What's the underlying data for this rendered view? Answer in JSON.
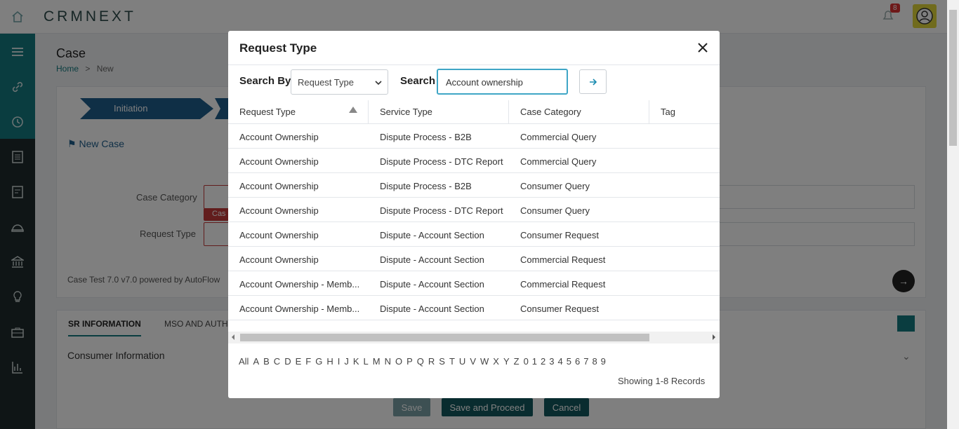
{
  "app": {
    "logo": "CRMNEXT",
    "notification_count": "8"
  },
  "page": {
    "title": "Case",
    "breadcrumb": {
      "home": "Home",
      "sep": ">",
      "current": "New"
    },
    "stage": "Initiation",
    "new_case": "New Case",
    "case_category_label": "Case Category",
    "request_type_label": "Request Type",
    "error_tag": "Cas",
    "powered_by": "Case Test 7.0 v7.0 powered by AutoFlow",
    "tabs": [
      "SR INFORMATION",
      "MSO AND AUTH"
    ],
    "section": "Consumer Information",
    "buttons": {
      "save": "Save",
      "save_proceed": "Save and Proceed",
      "cancel": "Cancel"
    }
  },
  "modal": {
    "title": "Request Type",
    "search_by_label": "Search By",
    "search_by_value": "Request Type",
    "search_label": "Search",
    "search_value": "Account ownership",
    "columns": [
      "Request Type",
      "Service Type",
      "Case Category",
      "Tag"
    ],
    "rows": [
      [
        "Account Ownership",
        "Dispute Process - B2B",
        "Commercial Query",
        ""
      ],
      [
        "Account Ownership",
        "Dispute Process - DTC Report",
        "Commercial Query",
        ""
      ],
      [
        "Account Ownership",
        "Dispute Process - B2B",
        "Consumer Query",
        ""
      ],
      [
        "Account Ownership",
        "Dispute Process - DTC Report",
        "Consumer Query",
        ""
      ],
      [
        "Account Ownership",
        "Dispute - Account Section",
        "Consumer Request",
        ""
      ],
      [
        "Account Ownership",
        "Dispute - Account Section",
        "Commercial Request",
        ""
      ],
      [
        "Account Ownership - Memb...",
        "Dispute - Account Section",
        "Commercial Request",
        ""
      ],
      [
        "Account Ownership - Memb...",
        "Dispute - Account Section",
        "Consumer Request",
        ""
      ]
    ],
    "alphabet": [
      "All",
      "A",
      "B",
      "C",
      "D",
      "E",
      "F",
      "G",
      "H",
      "I",
      "J",
      "K",
      "L",
      "M",
      "N",
      "O",
      "P",
      "Q",
      "R",
      "S",
      "T",
      "U",
      "V",
      "W",
      "X",
      "Y",
      "Z",
      "0",
      "1",
      "2",
      "3",
      "4",
      "5",
      "6",
      "7",
      "8",
      "9"
    ],
    "records": "Showing 1-8 Records"
  }
}
